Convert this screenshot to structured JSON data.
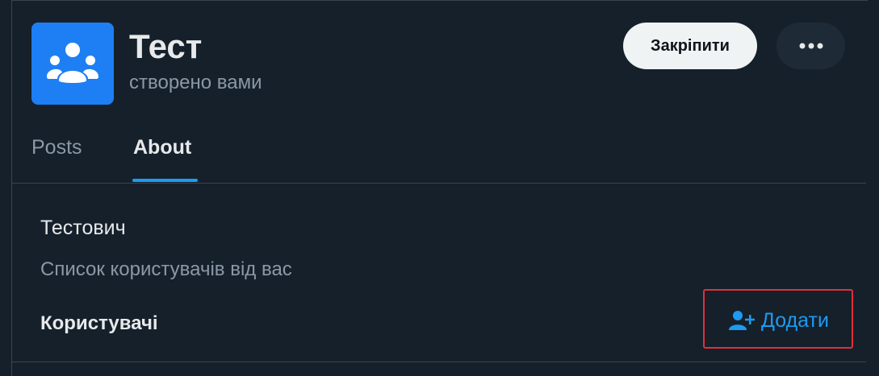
{
  "group": {
    "title": "Тест",
    "subtitle": "створено вами",
    "avatar_icon": "group-icon",
    "avatar_color": "#1d7ff3"
  },
  "header_actions": {
    "pin_label": "Закріпити",
    "more_icon": "more-dots-icon"
  },
  "tabs": [
    {
      "label": "Posts",
      "active": false
    },
    {
      "label": "About",
      "active": true
    }
  ],
  "about": {
    "name": "Тестович",
    "description": "Список користувачів від вас",
    "users_label": "Користувачі",
    "add_label": "Додати",
    "add_icon": "add-user-icon"
  },
  "colors": {
    "background": "#15202b",
    "accent": "#1d9bf0",
    "highlight_border": "#e0303a"
  }
}
